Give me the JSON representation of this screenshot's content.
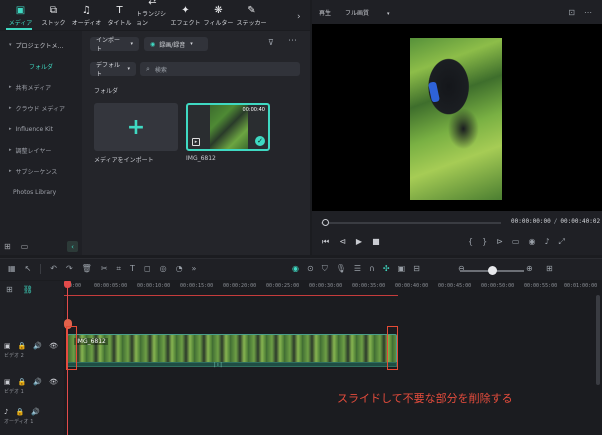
{
  "toolbar": {
    "items": [
      {
        "label": "メディア",
        "icon": "media-icon"
      },
      {
        "label": "ストック",
        "icon": "stock-icon"
      },
      {
        "label": "オーディオ",
        "icon": "music-icon"
      },
      {
        "label": "タイトル",
        "icon": "title-icon"
      },
      {
        "label": "トランジション",
        "icon": "transition-icon"
      },
      {
        "label": "エフェクト",
        "icon": "effect-icon"
      },
      {
        "label": "フィルター",
        "icon": "filter-icon"
      },
      {
        "label": "ステッカー",
        "icon": "sticker-icon"
      }
    ],
    "active_index": 0
  },
  "sidebar": {
    "project_media": "プロジェクトメ...",
    "folder": "フォルダ",
    "shared_media": "共有メディア",
    "cloud_media": "クラウド メディア",
    "influence_kit": "Influence Kit",
    "adjustment_layer": "調整レイヤー",
    "subsequence": "サブシーケンス",
    "photos_library": "Photos Library"
  },
  "media": {
    "import_dropdown": "インポート",
    "record_dropdown": "録画/録音",
    "default_dropdown": "デフォルト",
    "search_placeholder": "検索",
    "folder_label": "フォルダ",
    "import_tile_label": "メディアをインポート",
    "clip": {
      "name": "IMG_6812",
      "duration": "00:00:40"
    }
  },
  "player": {
    "label": "再生",
    "quality": "フル画質",
    "current_time": "00:00:00:00",
    "total_time": "00:00:40:02"
  },
  "timeline": {
    "ruler_ticks": [
      "00:00",
      "00:00:05:00",
      "00:00:10:00",
      "00:00:15:00",
      "00:00:20:00",
      "00:00:25:00",
      "00:00:30:00",
      "00:00:35:00",
      "00:00:40:00",
      "00:00:45:00",
      "00:00:50:00",
      "00:00:55:00",
      "00:01:00:00"
    ],
    "tracks": [
      {
        "name": "ビデオ 2"
      },
      {
        "name": "ビデオ 1"
      },
      {
        "name": "オーディオ 1"
      }
    ],
    "clip_label": "IMG_6812",
    "caption": "スライドして不要な部分を削除する"
  },
  "colors": {
    "accent": "#3fd9c2",
    "annotation": "#e64c3c"
  }
}
